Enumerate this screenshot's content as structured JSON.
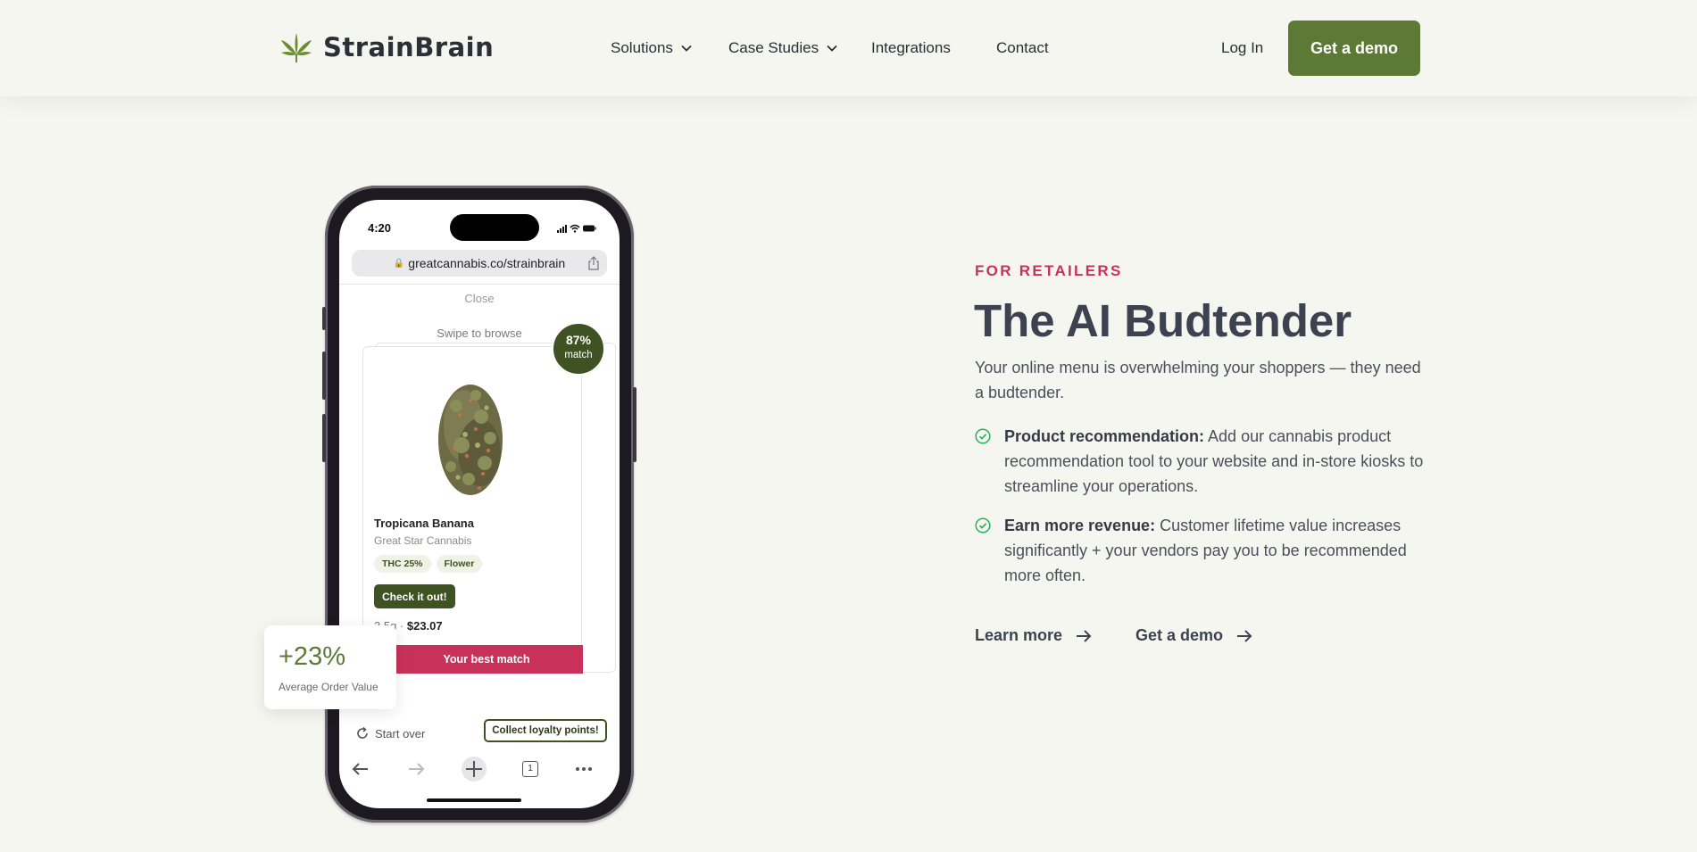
{
  "header": {
    "brand": "StrainBrain",
    "nav": [
      {
        "label": "Solutions",
        "dropdown": true
      },
      {
        "label": "Case Studies",
        "dropdown": true
      },
      {
        "label": "Integrations",
        "dropdown": false
      },
      {
        "label": "Contact",
        "dropdown": false
      }
    ],
    "login_label": "Log In",
    "demo_label": "Get a demo"
  },
  "phone": {
    "status_time": "4:20",
    "url": "greatcannabis.co/strainbrain",
    "close_label": "Close",
    "swipe_label": "Swipe to browse",
    "match_percent": "87%",
    "match_label": "match",
    "product": {
      "name": "Tropicana Banana",
      "brand": "Great Star Cannabis",
      "tags": [
        "THC 25%",
        "Flower"
      ],
      "cta": "Check it out!",
      "size": "3.5g · ",
      "price": "$23.07"
    },
    "best_match_label": "Your best match",
    "start_over_label": "Start over",
    "loyalty_label": "Collect loyalty points!",
    "tab_count": "1"
  },
  "stat": {
    "value": "+23%",
    "label": "Average Order Value"
  },
  "hero": {
    "eyebrow": "FOR RETAILERS",
    "title": "The AI Budtender",
    "lede": "Your online menu is overwhelming your shoppers — they need a budtender.",
    "features": [
      {
        "title": "Product recommendation:",
        "text": " Add our cannabis product recommendation tool to your website and in-store kiosks to streamline your operations."
      },
      {
        "title": "Earn more revenue:",
        "text": " Customer lifetime value increases significantly + your vendors pay you to be recommended more often."
      }
    ],
    "ctas": [
      "Learn more",
      "Get a demo"
    ]
  },
  "colors": {
    "brand_green": "#5c7a36",
    "dark_green": "#3f5222",
    "accent_red": "#c8325a",
    "background": "#f6f6f1"
  },
  "icons": [
    "cannabis-leaf-icon",
    "chevron-down-icon",
    "lock-icon",
    "share-icon",
    "refresh-icon",
    "back-arrow-icon",
    "forward-arrow-icon",
    "plus-icon",
    "tabs-icon",
    "more-icon",
    "check-circle-icon",
    "arrow-right-icon"
  ]
}
